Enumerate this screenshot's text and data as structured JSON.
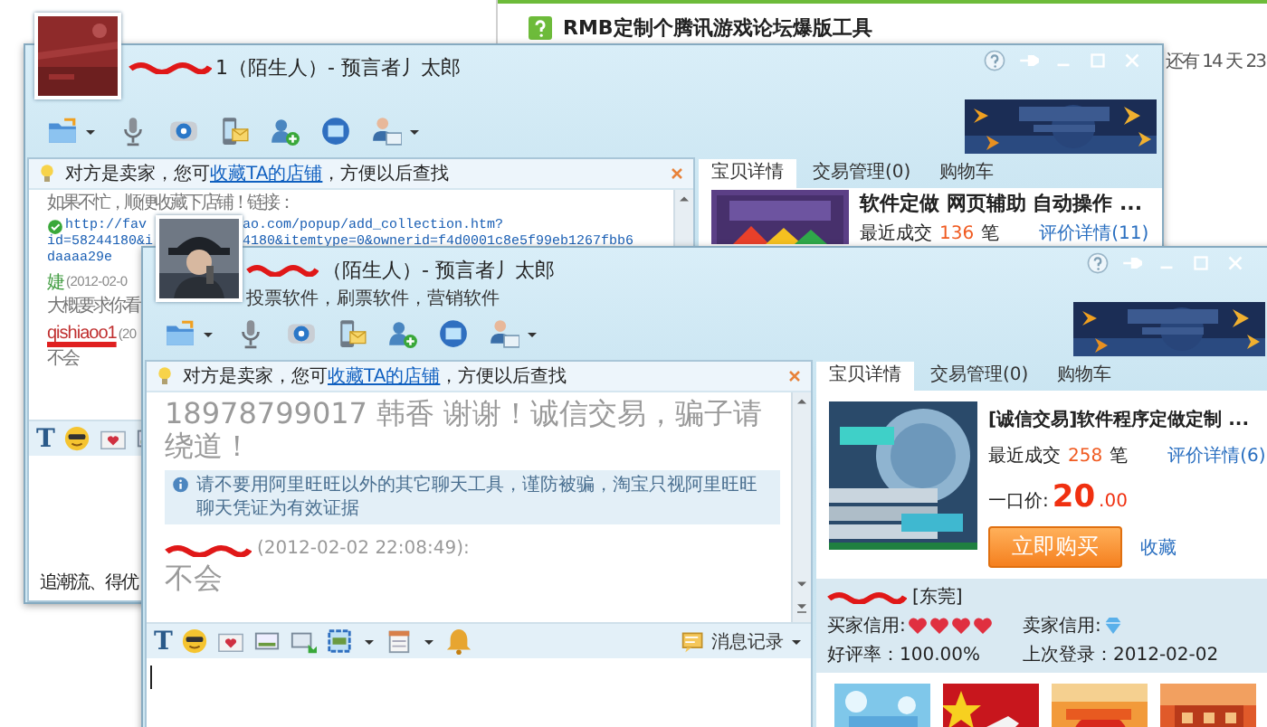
{
  "background_page": {
    "title": "RMB定制个腾讯游戏论坛爆版工具",
    "countdown": "还有 14 天 23"
  },
  "back_window": {
    "contact": {
      "name_redacted": true,
      "name": "1",
      "relation": "（陌生人）- 预言者丿太郎"
    },
    "notice": {
      "text": "对方是卖家，您可",
      "link": "收藏TA的店铺",
      "after": "，方便以后查找"
    },
    "messages": [
      {
        "kind": "text",
        "text": "如果不忙，顺便收藏下店铺！链接："
      },
      {
        "kind": "link",
        "lines": [
          [
            "http://fav",
            "ao.com/popup/add_collection.htm?"
          ],
          [
            "id=58244180&i",
            "4180&itemtype=0&ownerid=f4d0001c8e5f99eb1267fbb6"
          ],
          [
            "daaaa29e"
          ]
        ]
      },
      {
        "kind": "header",
        "sender": "婕",
        "color": "#3d9a3d",
        "sender_redacted": false,
        "time": "(2012-02-0"
      },
      {
        "kind": "text",
        "text": "大概要求你看"
      },
      {
        "kind": "header",
        "sender": "qishiaoo1",
        "color": "#c03030",
        "sender_redacted": true,
        "time": "(20"
      },
      {
        "kind": "text",
        "text": "不会"
      }
    ],
    "format_button": "T",
    "footer": "追潮流、得优",
    "tabs": [
      {
        "label": "宝贝详情",
        "selected": true
      },
      {
        "label": "交易管理(0)",
        "selected": false
      },
      {
        "label": "购物车",
        "selected": false
      }
    ],
    "product": {
      "title": "软件定做 网页辅助 自动操作 ...",
      "sales_label": "最近成交",
      "sales": "136",
      "sales_unit": "笔",
      "reviews": "评价详情(11)"
    }
  },
  "front_window": {
    "contact": {
      "name_redacted": true,
      "relation": "（陌生人）- 预言者丿太郎",
      "signature": "投票软件，刷票软件，营销软件"
    },
    "notice": {
      "text": "对方是卖家，您可",
      "link": "收藏TA的店铺",
      "after": "，方便以后查找"
    },
    "messages": [
      {
        "kind": "text",
        "text": "18978799017 韩香 谢谢！诚信交易，骗子请绕道！"
      },
      {
        "kind": "system",
        "text": "请不要用阿里旺旺以外的其它聊天工具，谨防被骗，淘宝只视阿里旺旺聊天凭证为有效证据"
      },
      {
        "kind": "header",
        "sender_redacted": true,
        "time": "(2012-02-02 22:08:49):"
      },
      {
        "kind": "text",
        "text": "不会"
      }
    ],
    "format_button": "T",
    "history": "消息记录",
    "tabs": [
      {
        "label": "宝贝详情",
        "selected": true
      },
      {
        "label": "交易管理(0)",
        "selected": false
      },
      {
        "label": "购物车",
        "selected": false
      }
    ],
    "product": {
      "title": "[诚信交易]软件程序定做定制 ...",
      "sales_label": "最近成交",
      "sales": "258",
      "sales_unit": "笔",
      "reviews": "评价详情(6)",
      "price_label": "一口价:",
      "price": "20",
      "price_cents": ".00",
      "buy": "立即购买",
      "favorite": "收藏"
    },
    "seller": {
      "name_redacted": true,
      "location": "[东莞]",
      "buyer_credit_label": "买家信用:",
      "stars": 4,
      "seller_credit_label": "卖家信用:",
      "rating": "好评率：100.00%",
      "last_login": "上次登录：2012-02-02"
    }
  }
}
